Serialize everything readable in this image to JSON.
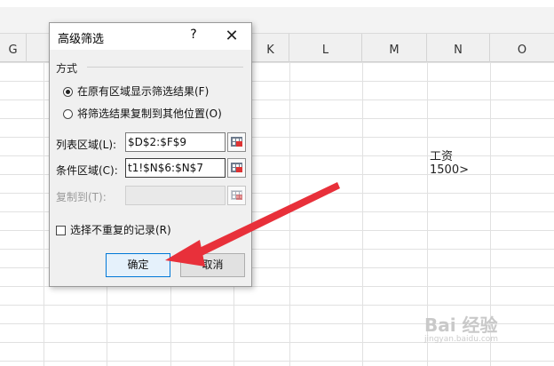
{
  "spreadsheet": {
    "columns": [
      {
        "label": "G"
      },
      {
        "label": "K"
      },
      {
        "label": "L"
      },
      {
        "label": "M"
      },
      {
        "label": "N"
      },
      {
        "label": "O"
      }
    ],
    "cells": [
      {
        "text": "工资"
      },
      {
        "text": "1500>"
      }
    ]
  },
  "dialog": {
    "title": "高级筛选",
    "help_label": "?",
    "close_label": "✕",
    "mode_group_label": "方式",
    "radio_in_place": "在原有区域显示筛选结果(F)",
    "radio_copy": "将筛选结果复制到其他位置(O)",
    "list_range_label": "列表区域(L):",
    "list_range_value": "$D$2:$F$9",
    "criteria_range_label": "条件区域(C):",
    "criteria_range_value": "t1!$N$6:$N$7",
    "copy_to_label": "复制到(T):",
    "copy_to_value": "",
    "unique_records_label": "选择不重复的记录(R)",
    "ok_label": "确定",
    "cancel_label": "取消"
  },
  "watermark": {
    "brand": "Bai 经验",
    "url": "jingyan.baidu.com"
  },
  "colors": {
    "ok_button_border": "#0078d7",
    "ok_button_fill": "#e5f1fb",
    "arrow": "#e8303a"
  },
  "icons": {
    "range_select": "range-select-icon",
    "close": "close-icon",
    "help": "help-icon"
  }
}
